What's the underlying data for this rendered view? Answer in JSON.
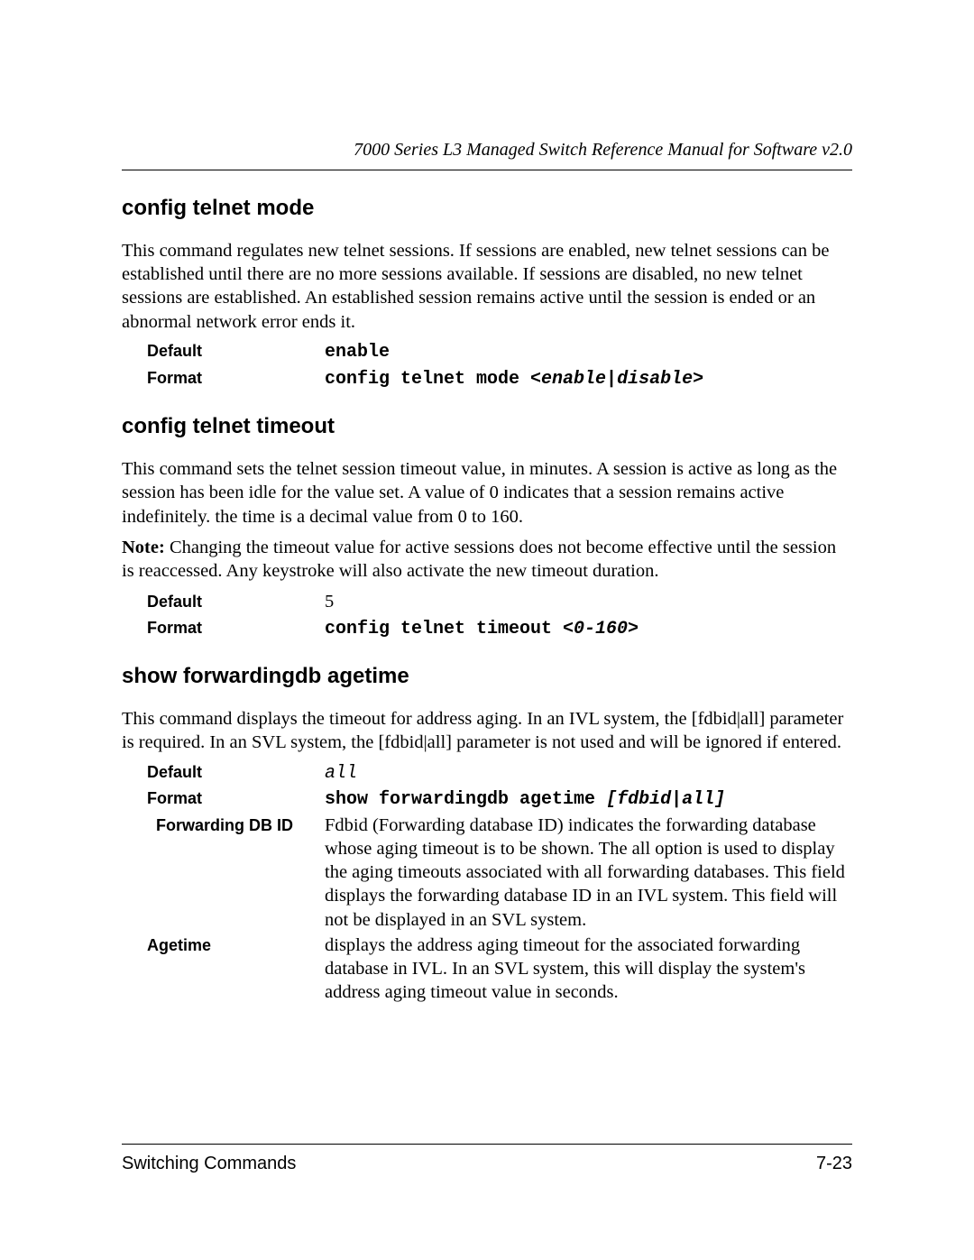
{
  "header": {
    "title": "7000 Series L3 Managed Switch Reference Manual for Software v2.0"
  },
  "sections": {
    "s1": {
      "heading": "config telnet mode",
      "body": "This command regulates new telnet sessions. If sessions are enabled, new telnet sessions can be established until there are no more sessions available. If sessions are disabled, no new telnet sessions are established. An established session remains active until the session is ended or an abnormal network error ends it.",
      "default_label": "Default",
      "default_value": "enable",
      "format_label": "Format",
      "format_cmd": "config telnet mode ",
      "format_arg": "<enable|disable>"
    },
    "s2": {
      "heading": "config telnet timeout",
      "body": "This command sets the telnet session timeout value, in minutes. A session is active as long as the session has been idle for the value set. A value of 0 indicates that a session remains active indefinitely. the time is a decimal value from 0 to 160.",
      "note_label": "Note:",
      "note_text": " Changing the timeout value for active sessions does not become effective until the session is reaccessed. Any keystroke will also activate the new timeout duration.",
      "default_label": "Default",
      "default_value": "5",
      "format_label": "Format",
      "format_cmd": "config telnet timeout ",
      "format_arg": "<0-160>"
    },
    "s3": {
      "heading": "show forwardingdb agetime",
      "body": "This command displays the timeout for address aging. In an IVL system, the [fdbid|all] parameter is required. In an SVL system, the [fdbid|all] parameter is not used and will be ignored if entered.",
      "default_label": "Default",
      "default_value": "all",
      "format_label": "Format",
      "format_cmd": "show forwardingdb agetime ",
      "format_arg": "[fdbid|all]",
      "fdbid_label": "Forwarding DB ID",
      "fdbid_text": "Fdbid (Forwarding database ID) indicates the forwarding database whose aging timeout is to be shown. The all option is used to display the aging timeouts associated with all forwarding databases. This field displays the forwarding database ID in an IVL system. This field will not be displayed in an SVL system.",
      "agetime_label": "Agetime",
      "agetime_text": "displays the address aging timeout for the associated forwarding database in IVL. In an SVL system, this will display the system's address aging timeout value in seconds."
    }
  },
  "footer": {
    "left": "Switching Commands",
    "right": "7-23"
  }
}
